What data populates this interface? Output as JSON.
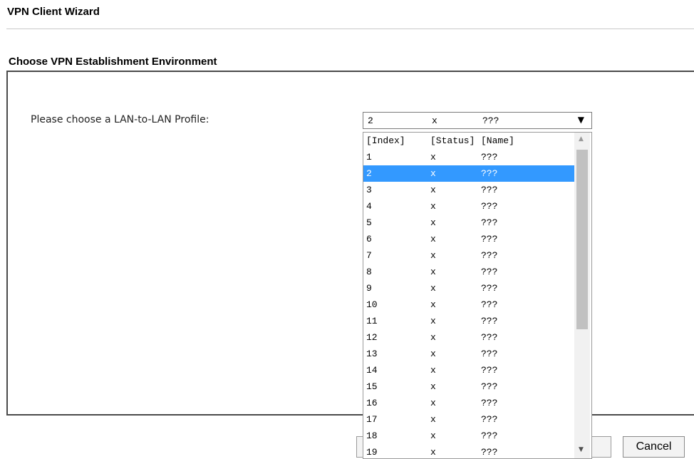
{
  "page_title": "VPN Client Wizard",
  "section_title": "Choose VPN Establishment Environment",
  "profile_label": "Please choose a LAN-to-LAN Profile:",
  "selected": {
    "index": "2",
    "status": "x",
    "name": "???"
  },
  "dropdown": {
    "header": {
      "index": "[Index]",
      "status": "[Status]",
      "name": "[Name]"
    },
    "options": [
      {
        "index": "1",
        "status": "x",
        "name": "???"
      },
      {
        "index": "2",
        "status": "x",
        "name": "???"
      },
      {
        "index": "3",
        "status": "x",
        "name": "???"
      },
      {
        "index": "4",
        "status": "x",
        "name": "???"
      },
      {
        "index": "5",
        "status": "x",
        "name": "???"
      },
      {
        "index": "6",
        "status": "x",
        "name": "???"
      },
      {
        "index": "7",
        "status": "x",
        "name": "???"
      },
      {
        "index": "8",
        "status": "x",
        "name": "???"
      },
      {
        "index": "9",
        "status": "x",
        "name": "???"
      },
      {
        "index": "10",
        "status": "x",
        "name": "???"
      },
      {
        "index": "11",
        "status": "x",
        "name": "???"
      },
      {
        "index": "12",
        "status": "x",
        "name": "???"
      },
      {
        "index": "13",
        "status": "x",
        "name": "???"
      },
      {
        "index": "14",
        "status": "x",
        "name": "???"
      },
      {
        "index": "15",
        "status": "x",
        "name": "???"
      },
      {
        "index": "16",
        "status": "x",
        "name": "???"
      },
      {
        "index": "17",
        "status": "x",
        "name": "???"
      },
      {
        "index": "18",
        "status": "x",
        "name": "???"
      },
      {
        "index": "19",
        "status": "x",
        "name": "???"
      }
    ],
    "highlight_color": "#3399ff"
  },
  "buttons": {
    "cancel": "Cancel"
  },
  "icons": {
    "dropdown_arrow": "chevron-down-icon",
    "scroll_up": "scroll-up-icon",
    "scroll_down": "scroll-down-icon"
  }
}
